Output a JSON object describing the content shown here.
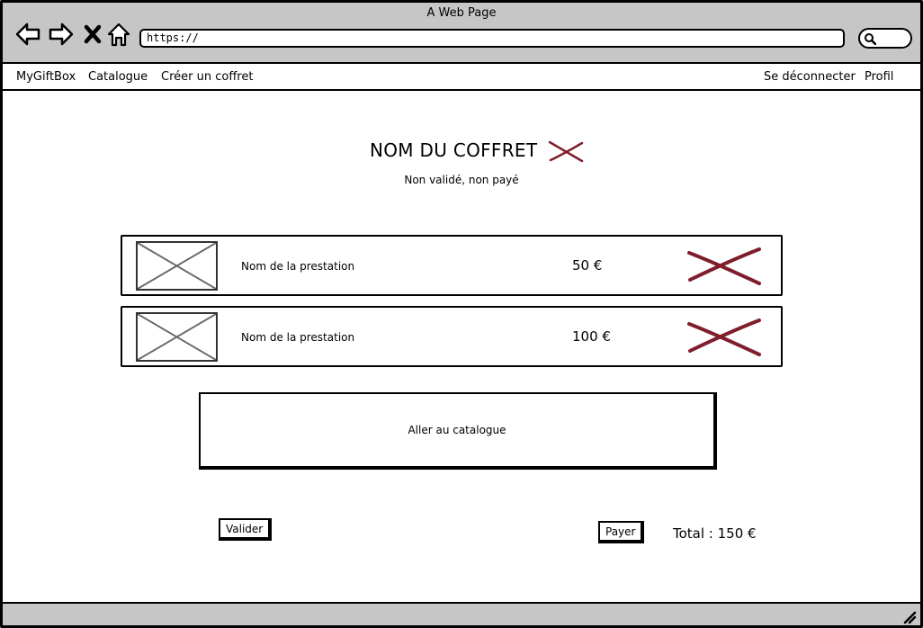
{
  "window": {
    "title": "A Web Page"
  },
  "address_bar": {
    "value": "https://"
  },
  "menu": {
    "left": [
      "MyGiftBox",
      "Catalogue",
      "Créer un coffret"
    ],
    "right": [
      "Se déconnecter",
      "Profil"
    ]
  },
  "box": {
    "title": "NOM DU COFFRET",
    "status": "Non validé, non payé"
  },
  "items": [
    {
      "name": "Nom de la prestation",
      "price": "50 €"
    },
    {
      "name": "Nom de la prestation",
      "price": "100 €"
    }
  ],
  "actions": {
    "catalog": "Aller au catalogue",
    "validate": "Valider",
    "pay": "Payer"
  },
  "total": "Total : 150 €",
  "colors": {
    "delete_cross": "#7f1d2b",
    "chrome": "#c6c6c6"
  }
}
